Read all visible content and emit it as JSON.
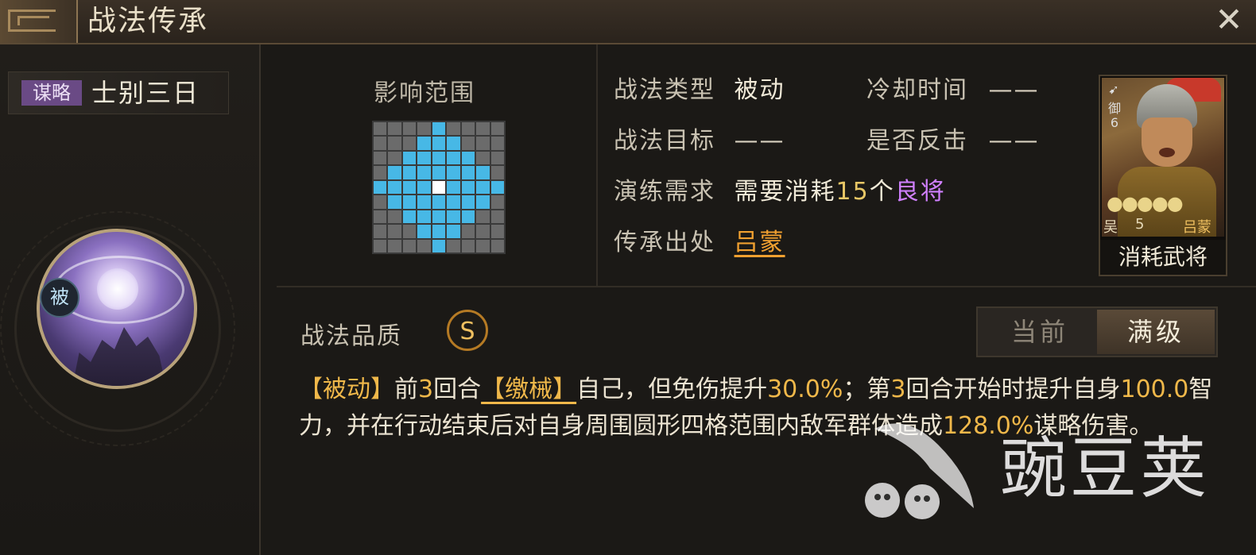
{
  "window": {
    "title": "战法传承",
    "close_icon": "close-icon"
  },
  "skill": {
    "category_tag": "谋略",
    "name": "士别三日",
    "passive_badge": "被"
  },
  "range": {
    "title": "影响范围",
    "grid_size": 9,
    "active_cells": [
      [
        0,
        4
      ],
      [
        1,
        3
      ],
      [
        1,
        4
      ],
      [
        1,
        5
      ],
      [
        2,
        2
      ],
      [
        2,
        3
      ],
      [
        2,
        4
      ],
      [
        2,
        5
      ],
      [
        2,
        6
      ],
      [
        3,
        1
      ],
      [
        3,
        2
      ],
      [
        3,
        3
      ],
      [
        3,
        4
      ],
      [
        3,
        5
      ],
      [
        3,
        6
      ],
      [
        3,
        7
      ],
      [
        4,
        0
      ],
      [
        4,
        1
      ],
      [
        4,
        2
      ],
      [
        4,
        3
      ],
      [
        4,
        5
      ],
      [
        4,
        6
      ],
      [
        4,
        7
      ],
      [
        4,
        8
      ],
      [
        5,
        1
      ],
      [
        5,
        2
      ],
      [
        5,
        3
      ],
      [
        5,
        4
      ],
      [
        5,
        5
      ],
      [
        5,
        6
      ],
      [
        5,
        7
      ],
      [
        6,
        2
      ],
      [
        6,
        3
      ],
      [
        6,
        4
      ],
      [
        6,
        5
      ],
      [
        6,
        6
      ],
      [
        7,
        3
      ],
      [
        7,
        4
      ],
      [
        7,
        5
      ],
      [
        8,
        4
      ]
    ],
    "center_cell": [
      4,
      4
    ],
    "colors": {
      "active": "#47b8e6",
      "center": "#ffffff",
      "inactive": "#6b6b6b"
    }
  },
  "info": {
    "type_label": "战法类型",
    "type_value": "被动",
    "cooldown_label": "冷却时间",
    "cooldown_value": "——",
    "target_label": "战法目标",
    "target_value": "——",
    "counter_label": "是否反击",
    "counter_value": "——",
    "train_label": "演练需求",
    "train_prefix": "需要消耗",
    "train_num": "15",
    "train_unit": "个",
    "train_grade": "良将",
    "source_label": "传承出处",
    "source_value": "吕蒙"
  },
  "general_card": {
    "troop_type": "御",
    "cost": "6",
    "stars": "●●●●●",
    "faction": "吴",
    "level": "5",
    "name": "吕蒙",
    "caption": "消耗武将"
  },
  "quality": {
    "label": "战法品质",
    "grade": "S"
  },
  "tabs": {
    "current": "当前",
    "max": "满级",
    "selected": "max"
  },
  "description": {
    "p1_tag": "【被动】",
    "p1_a": "前",
    "p1_num1": "3",
    "p1_b": "回合",
    "p1_status": "【缴械】",
    "p1_c": "自己，但免伤提升",
    "p1_num2": "30.0%",
    "p1_d": "；第",
    "p1_num3": "3",
    "p1_e": "回合开始时提升自身",
    "p1_num4": "100.0",
    "p1_f": "智力，并在行动结束后对自身周围圆形四格范围内敌军群体造成",
    "p1_num5": "128.0%",
    "p1_g": "谋略伤害。"
  },
  "watermark": {
    "text": "豌豆荚"
  }
}
